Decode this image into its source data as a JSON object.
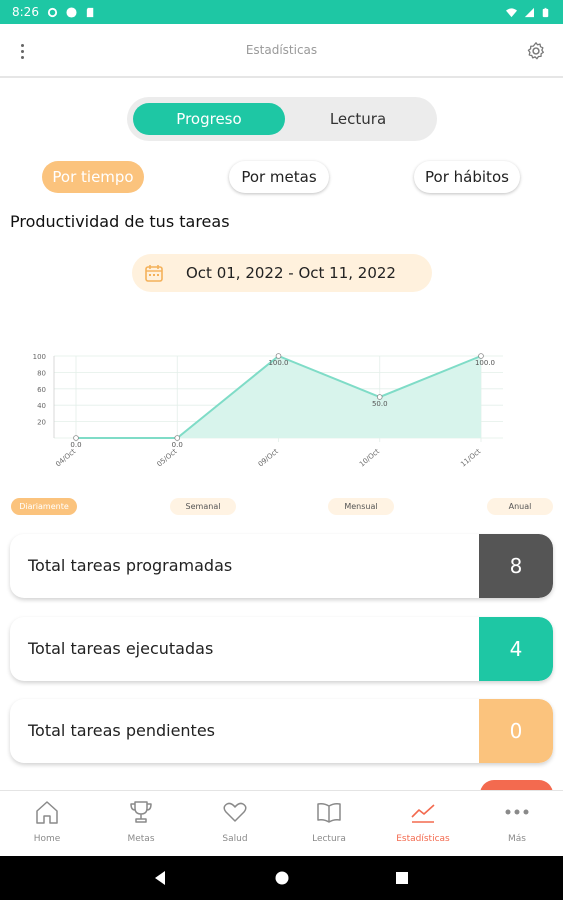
{
  "status_bar": {
    "time": "8:26"
  },
  "app_bar": {
    "title": "Estadísticas"
  },
  "tabs": [
    {
      "label": "Progreso",
      "active": true
    },
    {
      "label": "Lectura",
      "active": false
    }
  ],
  "filters": [
    {
      "label": "Por tiempo",
      "active": true
    },
    {
      "label": "Por metas",
      "active": false
    },
    {
      "label": "Por hábitos",
      "active": false
    }
  ],
  "section_title": "Productividad de tus tareas",
  "date_range": "Oct 01, 2022 - Oct 11, 2022",
  "chart_data": {
    "type": "area",
    "categories": [
      "04/Oct",
      "05/Oct",
      "09/Oct",
      "10/Oct",
      "11/Oct"
    ],
    "values": [
      0,
      0,
      100,
      50,
      100
    ],
    "data_labels": [
      "0.0",
      "0.0",
      "100.0",
      "50.0",
      "100.0"
    ],
    "y_ticks": [
      "20",
      "40",
      "60",
      "80",
      "100"
    ],
    "ylim": [
      0,
      100
    ],
    "grid": true,
    "color": "#7fdcc7",
    "fill": "#d8f4ec"
  },
  "periods": [
    {
      "label": "Diariamente",
      "active": true
    },
    {
      "label": "Semanal",
      "active": false
    },
    {
      "label": "Mensual",
      "active": false
    },
    {
      "label": "Anual",
      "active": false
    }
  ],
  "stats": [
    {
      "label": "Total tareas programadas",
      "value": "8",
      "color": "#555555"
    },
    {
      "label": "Total tareas ejecutadas",
      "value": "4",
      "color": "#1ec7a4"
    },
    {
      "label": "Total tareas pendientes",
      "value": "0",
      "color": "#fbc37d"
    }
  ],
  "nav": [
    {
      "label": "Home",
      "icon": "home-icon",
      "active": false
    },
    {
      "label": "Metas",
      "icon": "trophy-icon",
      "active": false
    },
    {
      "label": "Salud",
      "icon": "heart-icon",
      "active": false
    },
    {
      "label": "Lectura",
      "icon": "book-icon",
      "active": false
    },
    {
      "label": "Estadísticas",
      "icon": "chart-icon",
      "active": true
    },
    {
      "label": "Más",
      "icon": "more-icon",
      "active": false
    }
  ],
  "colors": {
    "accent": "#1ec7a4",
    "orange": "#fbc37d",
    "active_nav": "#f36a4f"
  }
}
